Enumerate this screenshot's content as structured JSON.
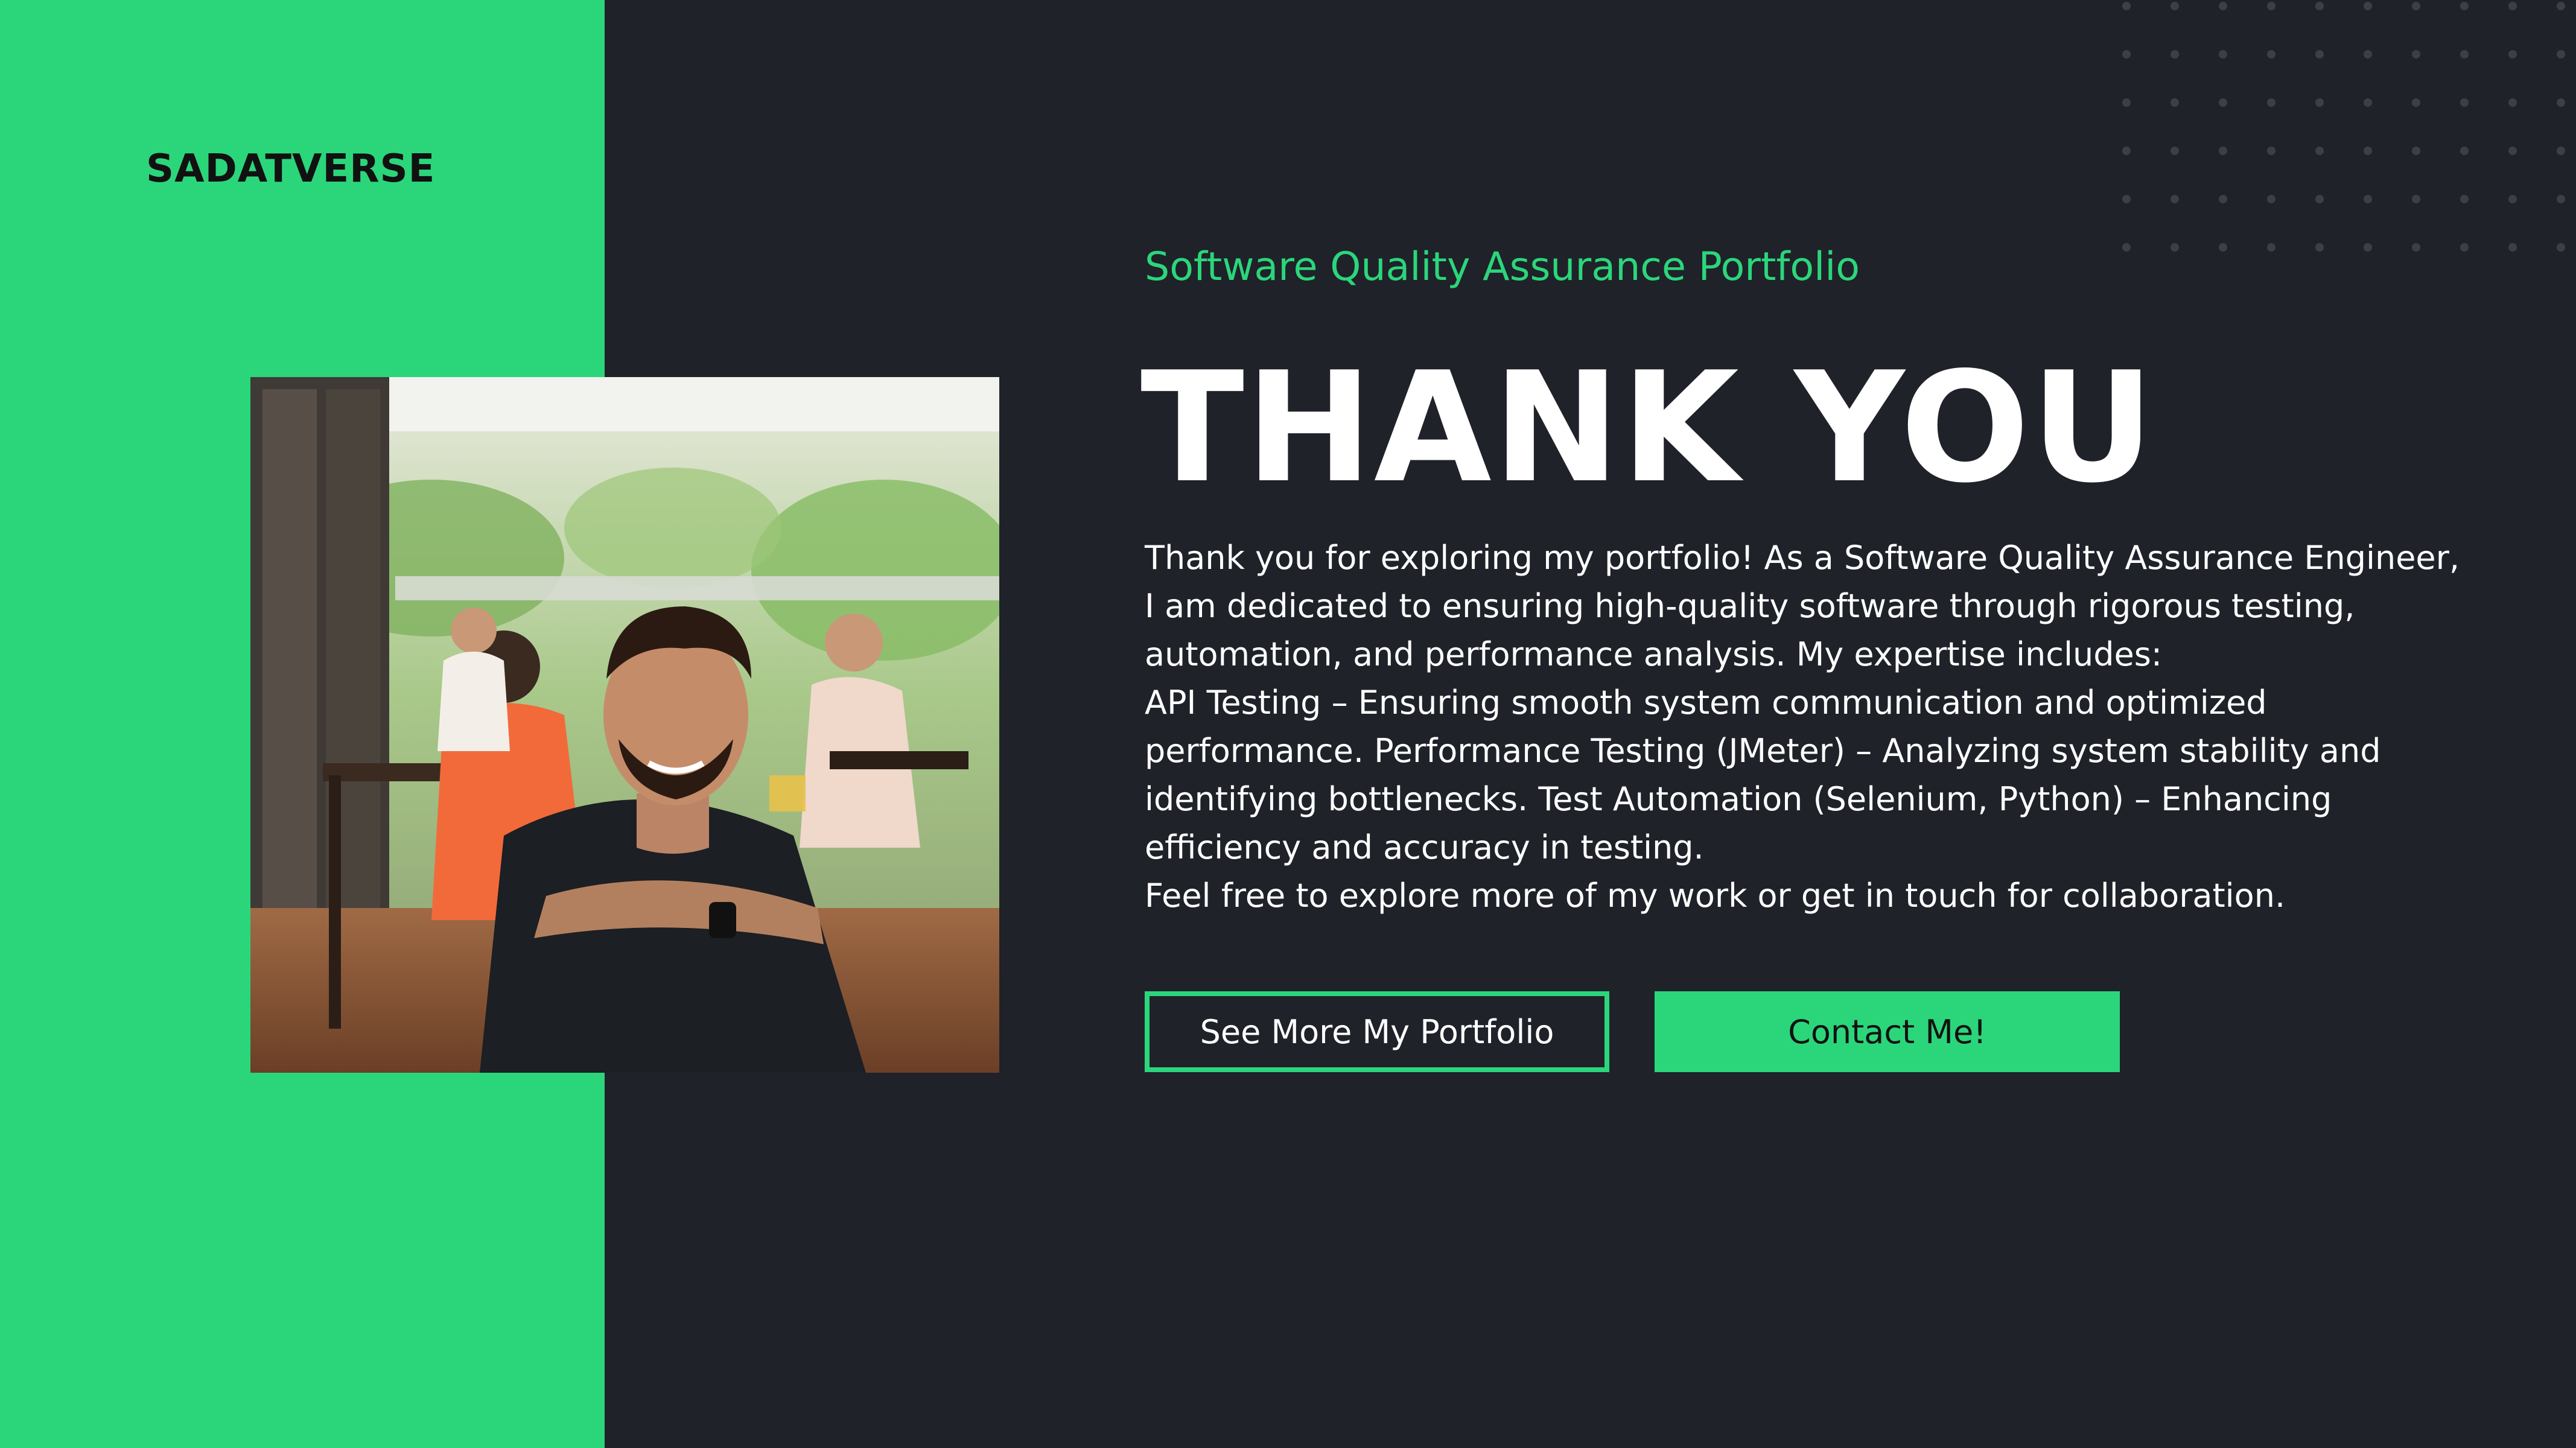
{
  "brand": {
    "name": "SADATVERSE"
  },
  "hero": {
    "subtitle": "Software Quality Assurance Portfolio",
    "headline": "THANK YOU",
    "paragraphs": [
      "Thank you for exploring my portfolio! As a Software Quality Assurance Engineer, I am dedicated to ensuring high-quality software through rigorous testing, automation, and performance analysis. My expertise includes:",
      "API Testing – Ensuring smooth system communication and optimized performance. Performance Testing (JMeter) – Analyzing system stability and identifying bottlenecks. Test Automation (Selenium, Python) – Enhancing efficiency and accuracy in testing.",
      "Feel free to explore more of my work or get in touch for collaboration."
    ]
  },
  "buttons": {
    "portfolio_label": "See More My Portfolio",
    "contact_label": "Contact Me!"
  },
  "colors": {
    "accent": "#2bd67b",
    "background": "#1f2229",
    "headline": "#ffffff",
    "brand_text": "#111111"
  },
  "icons": {
    "decoration": "dot-grid-pattern",
    "photo": "portrait-photo"
  }
}
